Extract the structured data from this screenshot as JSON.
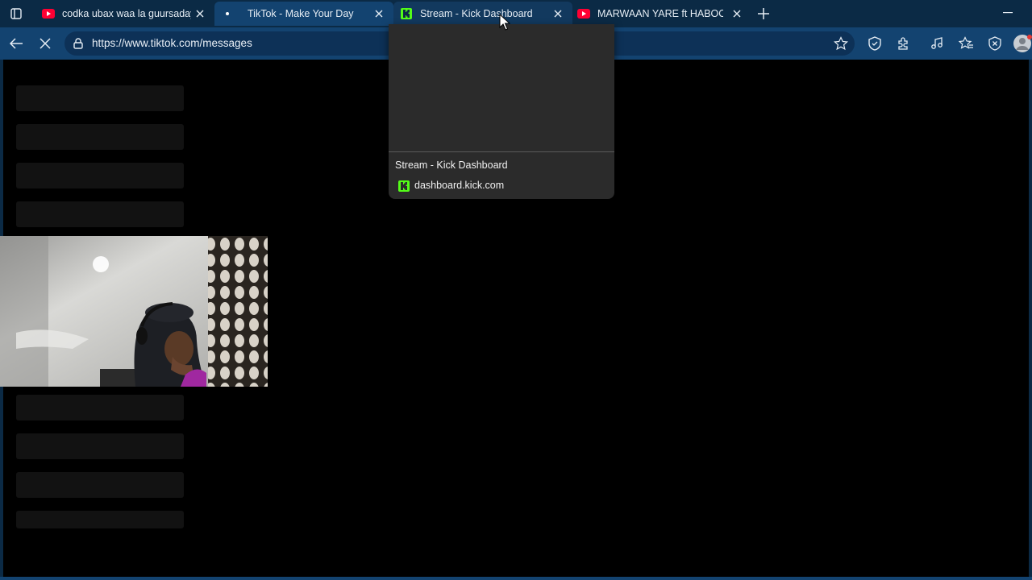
{
  "tabs": [
    {
      "title": "codka ubax waa la guursaday",
      "favicon": "youtube-icon",
      "state": "normal"
    },
    {
      "title": "TikTok - Make Your Day",
      "favicon": "loading-dot-icon",
      "state": "active"
    },
    {
      "title": "Stream - Kick Dashboard",
      "favicon": "kick-icon",
      "state": "hovered"
    },
    {
      "title": "MARWAAN YARE ft HABOON",
      "favicon": "youtube-icon",
      "state": "normal"
    }
  ],
  "address_bar": {
    "url": "https://www.tiktok.com/messages",
    "icon": "lock-icon"
  },
  "hover_card": {
    "title": "Stream - Kick Dashboard",
    "domain": "dashboard.kick.com",
    "favicon": "kick-icon"
  },
  "toolbar_icons": [
    "back-arrow-icon",
    "stop-loading-icon",
    "favorite-star-icon",
    "shield-extension-icon",
    "puzzle-extensions-icon",
    "media-control-icon",
    "favorites-icon",
    "browser-essentials-icon",
    "profile-avatar-icon"
  ],
  "colors": {
    "tab_strip": "#0b2a45",
    "active_tab": "#134370",
    "page_background": "#000000",
    "skeleton": "#121212",
    "kick_green": "#53fc18",
    "youtube_red": "#ff0033"
  }
}
